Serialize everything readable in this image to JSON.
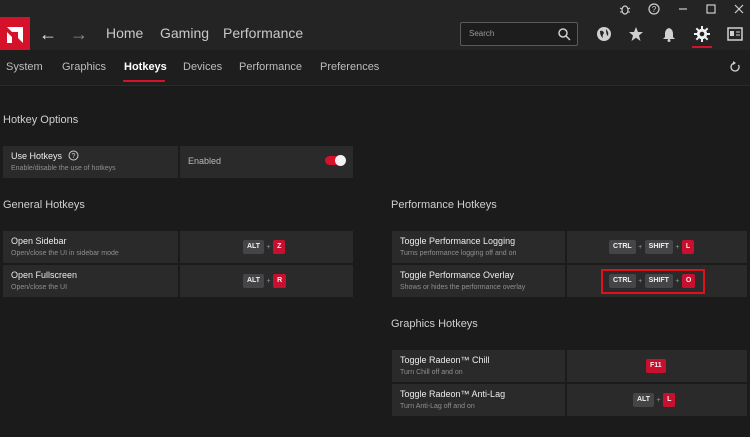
{
  "header": {
    "nav": [
      "Home",
      "Gaming",
      "Performance"
    ],
    "search_placeholder": "Search"
  },
  "icons": {
    "top": [
      "bug-icon",
      "help-icon",
      "minimize-icon",
      "maximize-icon",
      "close-icon"
    ],
    "toolbar": [
      "globe-icon",
      "star-icon",
      "bell-icon",
      "gear-icon",
      "account-icon"
    ]
  },
  "tabs": [
    "System",
    "Graphics",
    "Hotkeys",
    "Devices",
    "Performance",
    "Preferences"
  ],
  "active_tab": "Hotkeys",
  "hotkey_options": {
    "title": "Hotkey Options",
    "use_hotkeys": {
      "title": "Use Hotkeys",
      "desc": "Enable/disable the use of hotkeys",
      "status": "Enabled",
      "enabled": true
    }
  },
  "general": {
    "title": "General Hotkeys",
    "rows": [
      {
        "title": "Open Sidebar",
        "desc": "Open/close the UI in sidebar mode",
        "keys": [
          "ALT",
          "Z"
        ]
      },
      {
        "title": "Open Fullscreen",
        "desc": "Open/close the UI",
        "keys": [
          "ALT",
          "R"
        ]
      }
    ]
  },
  "performance": {
    "title": "Performance Hotkeys",
    "rows": [
      {
        "title": "Toggle Performance Logging",
        "desc": "Turns performance logging off and on",
        "keys": [
          "CTRL",
          "SHIFT",
          "L"
        ]
      },
      {
        "title": "Toggle Performance Overlay",
        "desc": "Shows or hides the performance overlay",
        "keys": [
          "CTRL",
          "SHIFT",
          "O"
        ]
      }
    ]
  },
  "graphics": {
    "title": "Graphics Hotkeys",
    "rows": [
      {
        "title": "Toggle Radeon™ Chill",
        "desc": "Turn Chill off and on",
        "keys": [
          "F11"
        ]
      },
      {
        "title": "Toggle Radeon™ Anti-Lag",
        "desc": "Turn Anti-Lag off and on",
        "keys": [
          "ALT",
          "L"
        ]
      }
    ]
  },
  "colors": {
    "accent": "#d6112a",
    "background": "#1b1b1c",
    "row": "#2a2a2b"
  }
}
